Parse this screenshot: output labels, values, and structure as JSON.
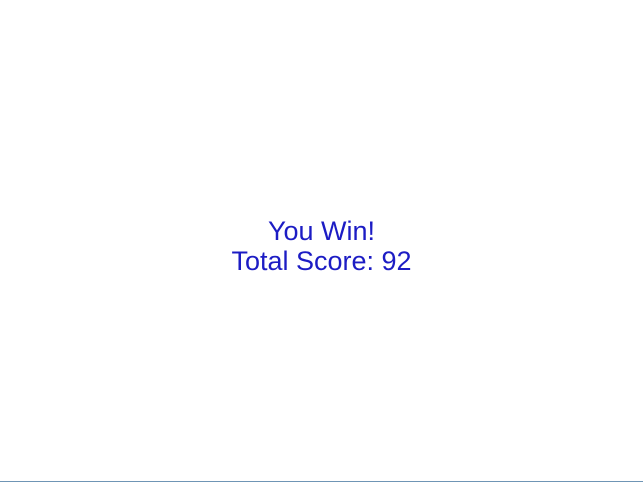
{
  "game": {
    "result_title": "You Win!",
    "score_label": "Total Score: ",
    "score_value": "92"
  },
  "colors": {
    "text": "#1c1cc4",
    "background": "#ffffff",
    "bottom_rule": "#6f95b5"
  }
}
